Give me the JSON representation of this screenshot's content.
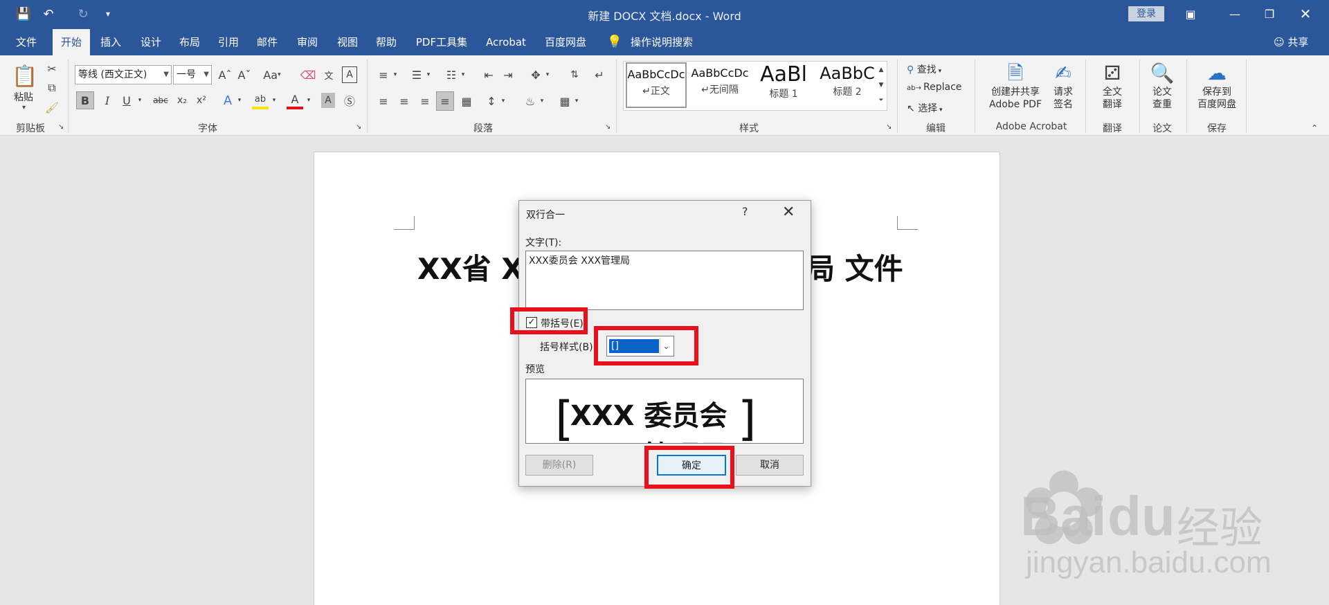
{
  "window": {
    "title": "新建 DOCX 文档.docx  -  Word",
    "login": "登录"
  },
  "quick_access": {
    "save_icon": "save-icon",
    "undo_icon": "undo-icon",
    "redo_icon": "redo-icon",
    "customize_icon": "customize-icon"
  },
  "tabs": [
    "文件",
    "开始",
    "插入",
    "设计",
    "布局",
    "引用",
    "邮件",
    "审阅",
    "视图",
    "帮助",
    "PDF工具集",
    "Acrobat",
    "百度网盘"
  ],
  "active_tab": "开始",
  "tell_me": "操作说明搜索",
  "share": "共享",
  "ribbon": {
    "clipboard": {
      "paste": "粘贴",
      "label": "剪贴板"
    },
    "font": {
      "name": "等线 (西文正文)",
      "size": "一号",
      "label": "字体",
      "case": "Aa",
      "wen": "文"
    },
    "paragraph": {
      "label": "段落"
    },
    "styles": {
      "label": "样式",
      "items": [
        {
          "sample": "AaBbCcDc",
          "name": "正文"
        },
        {
          "sample": "AaBbCcDc",
          "name": "无间隔"
        },
        {
          "sample": "AaBl",
          "name": "标题 1"
        },
        {
          "sample": "AaBbC",
          "name": "标题 2"
        }
      ]
    },
    "editing": {
      "find": "查找",
      "replace": "Replace",
      "select": "选择",
      "label": "编辑"
    },
    "acrobat": {
      "create_line1": "创建并共享",
      "create_line2": "Adobe PDF",
      "sign_line1": "请求",
      "sign_line2": "签名",
      "label": "Adobe Acrobat"
    },
    "translate": {
      "line1": "全文",
      "line2": "翻译",
      "label": "翻译"
    },
    "paper": {
      "line1": "论文",
      "line2": "查重",
      "label": "论文"
    },
    "save": {
      "line1": "保存到",
      "line2": "百度网盘",
      "label": "保存"
    }
  },
  "document": {
    "left_text": "XX省 X",
    "right_text": "局 文件"
  },
  "dialog": {
    "title": "双行合一",
    "help": "?",
    "text_label": "文字(T):",
    "text_value": "XXX委员会 XXX管理局",
    "bracket_checkbox_label": "带括号(E)",
    "bracket_checked": true,
    "bracket_style_label": "括号样式(B):",
    "bracket_style_value": "[]",
    "preview_label": "预览",
    "preview_left_bracket": "[",
    "preview_right_bracket": "]",
    "preview_line1": "XXX 委员会",
    "preview_line2": "XXX 管理局",
    "delete_button": "删除(R)",
    "ok_button": "确定",
    "cancel_button": "取消"
  },
  "watermark": {
    "brand": "Bai",
    "suffix": "经验",
    "url": "jingyan.baidu.com"
  },
  "colors": {
    "word_blue": "#2b579a",
    "highlight_red": "#e8101b",
    "selection_blue": "#0a64c8"
  }
}
